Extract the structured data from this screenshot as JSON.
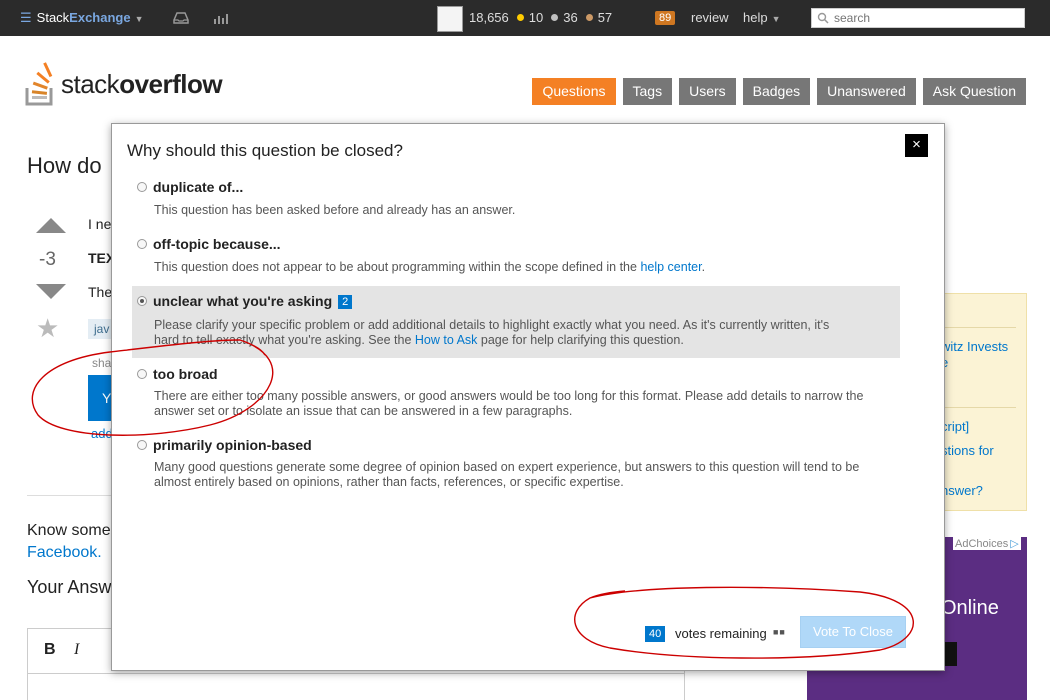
{
  "topbar": {
    "brand_first": "Stack",
    "brand_second": "Exchange",
    "reputation": "18,656",
    "gold_badges": "10",
    "silver_badges": "36",
    "bronze_badges": "57",
    "inbox_count": "89",
    "review_label": "review",
    "help_label": "help",
    "search_placeholder": "search",
    "colors": {
      "gold": "#ffcc00",
      "silver": "#c0c0c0",
      "bronze": "#cc9966",
      "inbox": "#cf7721"
    }
  },
  "header": {
    "logo_light": "stack",
    "logo_bold": "overflow",
    "nav": [
      "Questions",
      "Tags",
      "Users",
      "Badges",
      "Unanswered",
      "Ask Question"
    ],
    "active_nav": "Questions",
    "accent": "#f48024"
  },
  "page": {
    "question_title": "How do",
    "vote_count": "-3",
    "body_line1": "I ne",
    "body_line2": "TEX",
    "body_line3": "The",
    "tag": "jav",
    "share_text": "sha",
    "button_text": "Y",
    "add_link": "add",
    "know_text": "Know some",
    "facebook_text": "Facebook.",
    "your_answer": "Your Answ",
    "editor_bold": "B",
    "editor_italic": "I",
    "sidebar": {
      "line1": "witz Invests",
      "line2": "e",
      "line3": "cript]",
      "line4": "stions for",
      "line5": "nswer?"
    },
    "adchoices": "AdChoices",
    "ad_text": "Online"
  },
  "modal": {
    "title": "Why should this question be closed?",
    "close_label": "×",
    "options": [
      {
        "label": "duplicate of...",
        "description": "This question has been asked before and already has an answer.",
        "selected": false
      },
      {
        "label": "off-topic because...",
        "description": "This question does not appear to be about programming within the scope defined in the",
        "link": "help center",
        "suffix": ".",
        "selected": false
      },
      {
        "label": "unclear what you're asking",
        "count": "2",
        "description_a": "Please clarify your specific problem or add additional details to highlight exactly what you need. As it's currently written, it's",
        "description_b": "hard to tell exactly what you're asking. See the",
        "link": "How to Ask",
        "suffix": "page for help clarifying this question.",
        "selected": true
      },
      {
        "label": "too broad",
        "description_a": "There are either too many possible answers, or good answers would be too long for this format. Please add details to narrow the",
        "description_b": "answer set or to isolate an issue that can be answered in a few paragraphs.",
        "selected": false
      },
      {
        "label": "primarily opinion-based",
        "description_a": "Many good questions generate some degree of opinion based on expert experience, but answers to this question will tend to be",
        "description_b": "almost entirely based on opinions, rather than facts, references, or specific expertise.",
        "selected": false
      }
    ],
    "votes_remaining_count": "40",
    "votes_remaining_label": "votes remaining",
    "votes_dots": "■■",
    "vote_button": "Vote To Close"
  },
  "annotation_color": "#cc0000"
}
